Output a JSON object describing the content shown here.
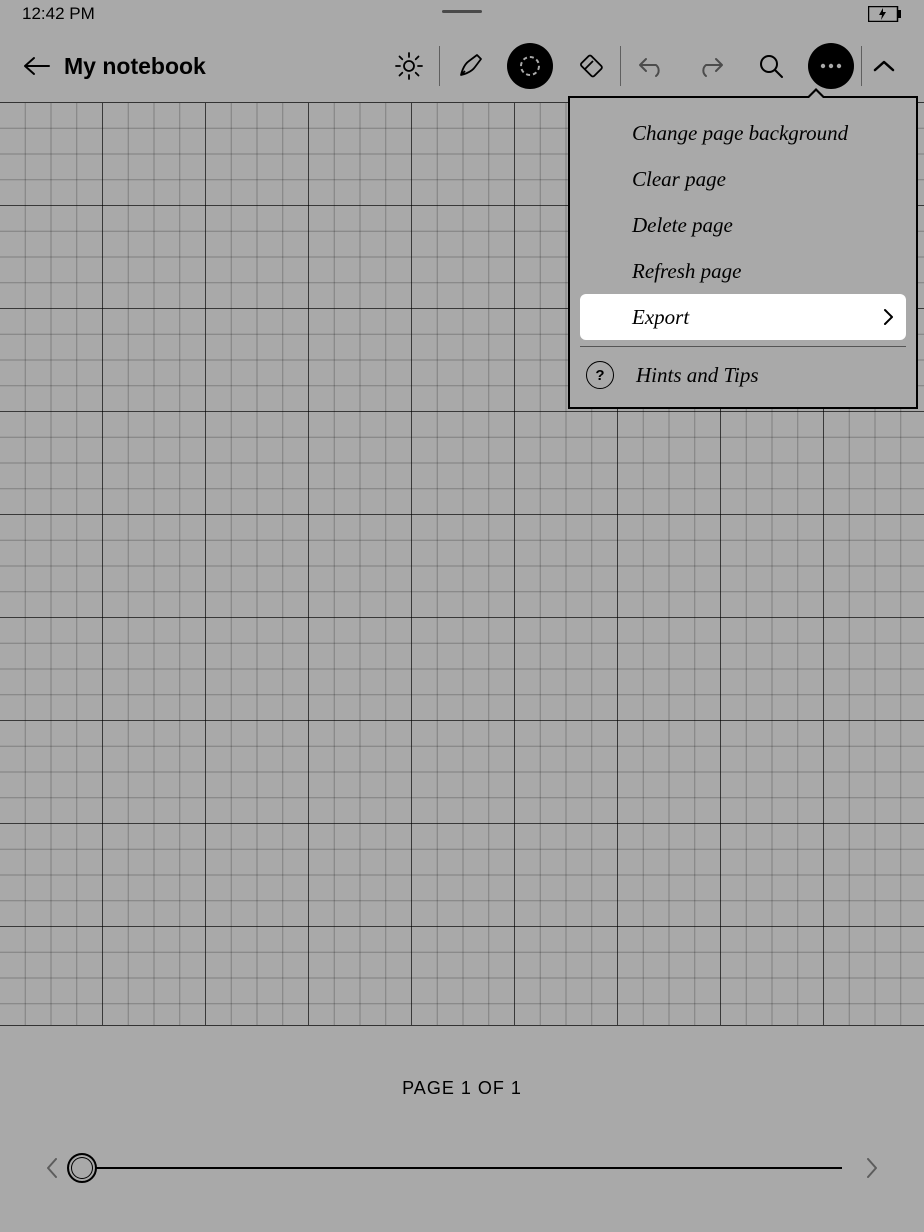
{
  "statusbar": {
    "time": "12:42 PM"
  },
  "toolbar": {
    "title": "My notebook",
    "icons": {
      "back": "back-icon",
      "brightness": "brightness-icon",
      "pen": "pen-icon",
      "lasso": "lasso-icon",
      "eraser": "eraser-icon",
      "undo": "undo-icon",
      "redo": "redo-icon",
      "search": "search-icon",
      "more": "more-icon",
      "expand": "chevron-up-icon"
    }
  },
  "menu": {
    "items": [
      {
        "label": "Change page background",
        "active": false
      },
      {
        "label": "Clear page",
        "active": false
      },
      {
        "label": "Delete page",
        "active": false
      },
      {
        "label": "Refresh page",
        "active": false
      },
      {
        "label": "Export",
        "active": true
      }
    ],
    "hints_label": "Hints and Tips"
  },
  "pager": {
    "label": "PAGE 1 OF 1"
  }
}
